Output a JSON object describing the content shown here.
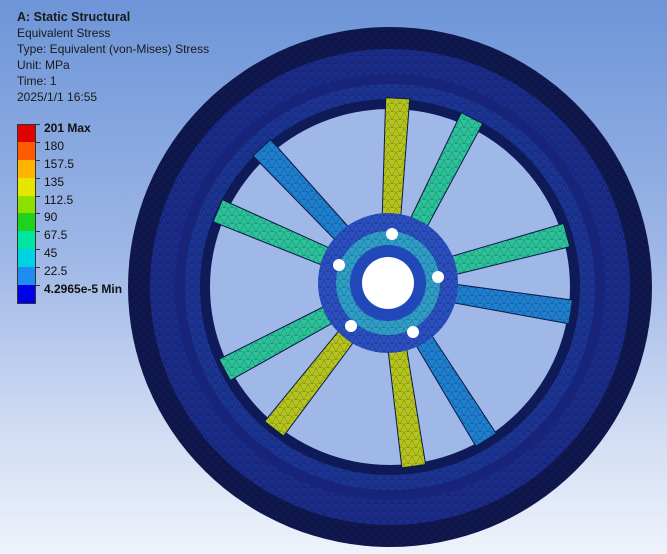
{
  "header": {
    "title": "A: Static Structural",
    "result_name": "Equivalent Stress",
    "type": "Type: Equivalent (von-Mises) Stress",
    "unit": "Unit: MPa",
    "time": "Time: 1",
    "timestamp": "2025/1/1 16:55"
  },
  "legend": {
    "entries": [
      {
        "label": "201 Max",
        "color": "#e00000",
        "bold": true
      },
      {
        "label": "180",
        "color": "#ff5a00"
      },
      {
        "label": "157.5",
        "color": "#ffb400"
      },
      {
        "label": "135",
        "color": "#e6e600"
      },
      {
        "label": "112.5",
        "color": "#8ce000"
      },
      {
        "label": "90",
        "color": "#1ed21e"
      },
      {
        "label": "67.5",
        "color": "#00e6a0"
      },
      {
        "label": "45",
        "color": "#00d2e6"
      },
      {
        "label": "22.5",
        "color": "#1e8cf0"
      },
      {
        "label": "4.2965e-5 Min",
        "color": "#0000e6",
        "bold": true
      }
    ]
  },
  "colors": {
    "rim_dark": "#121a55",
    "rim_mid": "#1c2e8c",
    "spoke_low": "#1f7fd0",
    "spoke_mid": "#2cc39a",
    "spoke_high": "#b6c41e",
    "hub": "#2747b8"
  },
  "icons": {
    "wheel": "wheel-model-icon"
  }
}
